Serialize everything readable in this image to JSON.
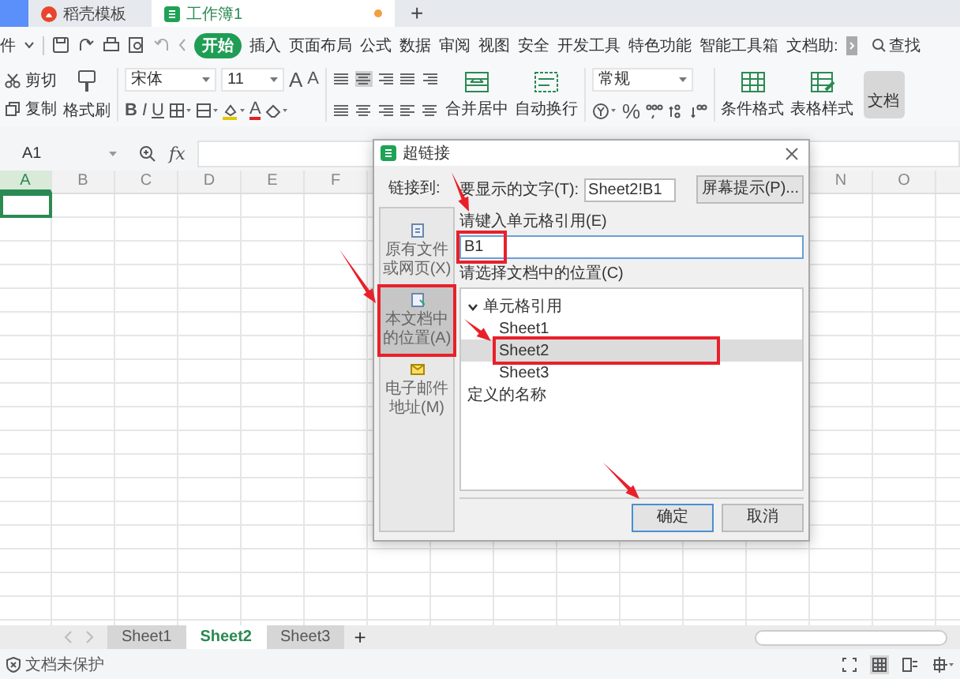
{
  "app_tabs": {
    "tabs": [
      {
        "label": "稻壳模板",
        "kind": "docer",
        "selected": false,
        "unsaved": false
      },
      {
        "label": "工作簿1",
        "kind": "sheet",
        "selected": true,
        "unsaved": true
      }
    ],
    "new_tab": "+"
  },
  "menu": {
    "file_label": "件",
    "items": [
      {
        "label": "开始",
        "selected": true
      },
      {
        "label": "插入",
        "selected": false
      },
      {
        "label": "页面布局",
        "selected": false
      },
      {
        "label": "公式",
        "selected": false
      },
      {
        "label": "数据",
        "selected": false
      },
      {
        "label": "审阅",
        "selected": false
      },
      {
        "label": "视图",
        "selected": false
      },
      {
        "label": "安全",
        "selected": false
      },
      {
        "label": "开发工具",
        "selected": false
      },
      {
        "label": "特色功能",
        "selected": false
      },
      {
        "label": "智能工具箱",
        "selected": false
      },
      {
        "label": "文档助:",
        "selected": false
      }
    ],
    "search": "查找"
  },
  "ribbon": {
    "cut": "剪切",
    "copy": "复制",
    "format_painter": "格式刷",
    "font": "宋体",
    "size": "11",
    "grow": "A",
    "shrink": "A",
    "bold": "B",
    "italic": "I",
    "underline": "U",
    "font_color": "A",
    "merge": "合并居中",
    "wrap": "自动换行",
    "number_format": "常规",
    "percent": "%",
    "conditional": "条件格式",
    "table_style": "表格样式",
    "doc": "文档"
  },
  "formula_bar": {
    "name_box": "A1",
    "fx": "fx"
  },
  "sheet": {
    "columns": [
      {
        "label": "A",
        "selected": true
      },
      {
        "label": "B",
        "selected": false
      },
      {
        "label": "C",
        "selected": false
      },
      {
        "label": "D",
        "selected": false
      },
      {
        "label": "E",
        "selected": false
      },
      {
        "label": "F",
        "selected": false
      }
    ],
    "columns_after_dialog": [
      {
        "label": "N",
        "selected": false
      },
      {
        "label": "O",
        "selected": false
      }
    ]
  },
  "dialog": {
    "title": "超链接",
    "link_to_label": "链接到:",
    "targets": [
      {
        "label": "原有文件或网页(X)",
        "selected": false
      },
      {
        "label": "本文档中的位置(A)",
        "selected": true
      },
      {
        "label": "电子邮件地址(M)",
        "selected": false
      }
    ],
    "display_text_label": "要显示的文字(T):",
    "display_text": "Sheet2!B1",
    "screentip": "屏幕提示(P)...",
    "cell_ref_label": "请键入单元格引用(E)",
    "cell_ref": "B1",
    "location_label": "请选择文档中的位置(C)",
    "tree": [
      {
        "label": "单元格引用",
        "expanded": true,
        "selected": false,
        "children": [
          {
            "label": "Sheet1",
            "selected": false
          },
          {
            "label": "Sheet2",
            "selected": true
          },
          {
            "label": "Sheet3",
            "selected": false
          }
        ]
      },
      {
        "label": "定义的名称",
        "selected": false
      }
    ],
    "buttons": [
      {
        "label": "确定",
        "kind": "primary"
      },
      {
        "label": "取消",
        "kind": "normal"
      }
    ]
  },
  "sheet_tabs": {
    "tabs": [
      {
        "label": "Sheet1",
        "selected": false
      },
      {
        "label": "Sheet2",
        "selected": true
      },
      {
        "label": "Sheet3",
        "selected": false
      }
    ],
    "add": "+"
  },
  "status_bar": {
    "protection": "文档未保护"
  }
}
